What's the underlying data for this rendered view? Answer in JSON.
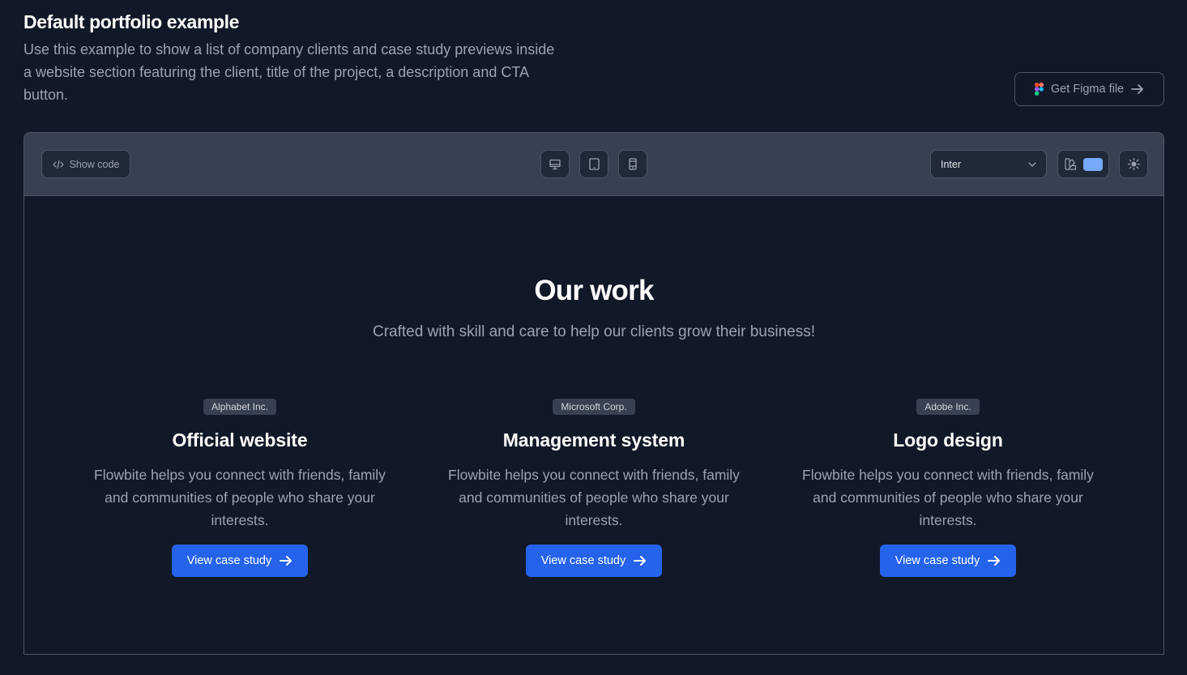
{
  "header": {
    "title": "Default portfolio example",
    "description": "Use this example to show a list of company clients and case study previews inside a website section featuring the client, title of the project, a description and CTA button.",
    "figma_button": {
      "label": "Get Figma file",
      "icon": "figma-icon",
      "trailing_icon": "arrow-right-icon"
    }
  },
  "toolbar": {
    "show_code": {
      "label": "Show code",
      "icon": "code-icon"
    },
    "device_buttons": [
      {
        "name": "desktop",
        "icon": "desktop-icon"
      },
      {
        "name": "tablet",
        "icon": "tablet-icon"
      },
      {
        "name": "mobile",
        "icon": "mobile-icon"
      }
    ],
    "font_select": {
      "value": "Inter",
      "icon": "chevron-down-icon"
    },
    "color_picker": {
      "icon": "swatch-book-icon",
      "color": "#76a9fa"
    },
    "theme_toggle": {
      "icon": "sun-icon"
    }
  },
  "preview": {
    "title": "Our work",
    "subtitle": "Crafted with skill and care to help our clients grow their business!",
    "cards": [
      {
        "client": "Alphabet Inc.",
        "title": "Official website",
        "description": "Flowbite helps you connect with friends, family and communities of people who share your interests.",
        "cta": "View case study"
      },
      {
        "client": "Microsoft Corp.",
        "title": "Management system",
        "description": "Flowbite helps you connect with friends, family and communities of people who share your interests.",
        "cta": "View case study"
      },
      {
        "client": "Adobe Inc.",
        "title": "Logo design",
        "description": "Flowbite helps you connect with friends, family and communities of people who share your interests.",
        "cta": "View case study"
      }
    ]
  },
  "colors": {
    "background": "#111827",
    "toolbar": "#374151",
    "primary": "#2563eb",
    "muted_text": "#9ca3af",
    "badge_bg": "#374151"
  }
}
